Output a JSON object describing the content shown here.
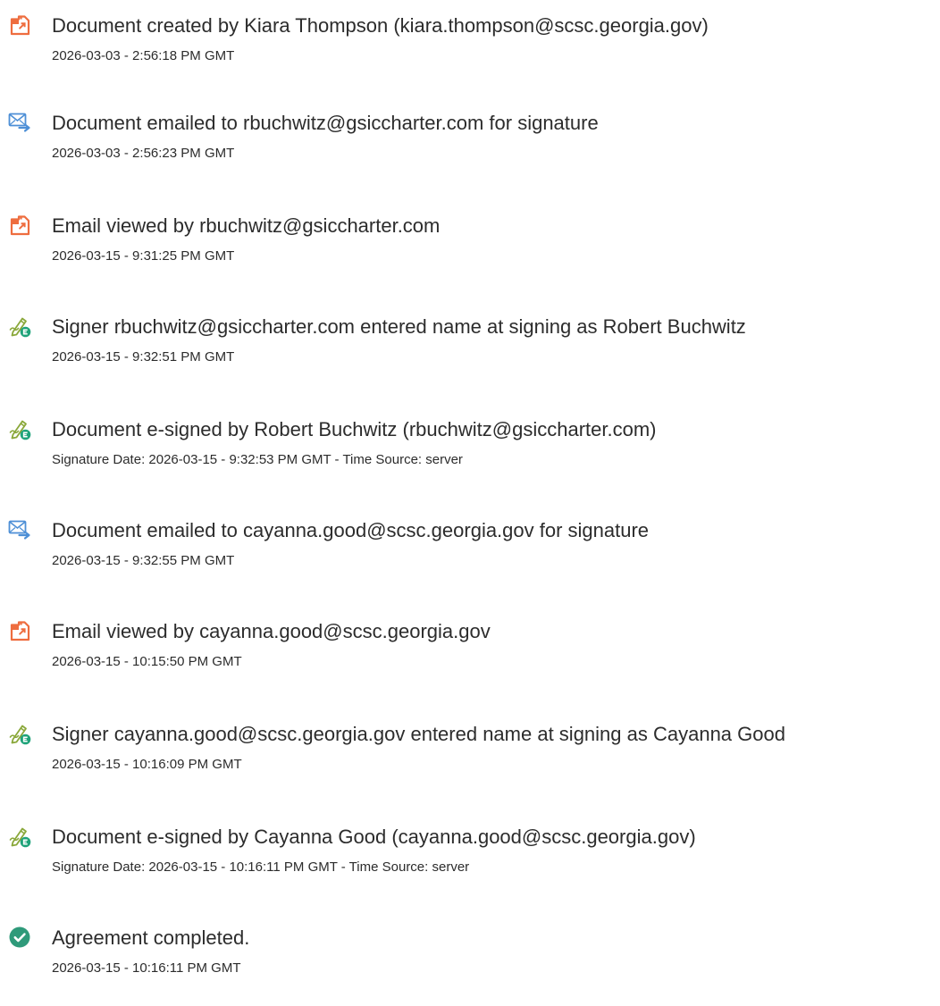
{
  "colors": {
    "document_icon": "#ee6d3f",
    "email_icon": "#4d8fd6",
    "signature_icon": "#8aa83a",
    "signature_badge": "#1fa37a",
    "completed_icon": "#2f9a7a"
  },
  "events": [
    {
      "icon": "document-created-icon",
      "title": "Document created by Kiara Thompson (kiara.thompson@scsc.georgia.gov)",
      "timestamp": "2026-03-03 - 2:56:18 PM GMT"
    },
    {
      "icon": "email-sent-icon",
      "title": "Document emailed to rbuchwitz@gsiccharter.com for signature",
      "timestamp": "2026-03-03 - 2:56:23 PM GMT"
    },
    {
      "icon": "document-viewed-icon",
      "title": "Email viewed by rbuchwitz@gsiccharter.com",
      "timestamp": "2026-03-15 - 9:31:25 PM GMT"
    },
    {
      "icon": "signature-pen-icon",
      "title": "Signer rbuchwitz@gsiccharter.com entered name at signing as Robert Buchwitz",
      "timestamp": "2026-03-15 - 9:32:51 PM GMT"
    },
    {
      "icon": "signature-pen-icon",
      "title": "Document e-signed by Robert Buchwitz (rbuchwitz@gsiccharter.com)",
      "timestamp": "Signature Date: 2026-03-15 - 9:32:53 PM GMT - Time Source: server"
    },
    {
      "icon": "email-sent-icon",
      "title": "Document emailed to cayanna.good@scsc.georgia.gov for signature",
      "timestamp": "2026-03-15 - 9:32:55 PM GMT"
    },
    {
      "icon": "document-viewed-icon",
      "title": "Email viewed by cayanna.good@scsc.georgia.gov",
      "timestamp": "2026-03-15 - 10:15:50 PM GMT"
    },
    {
      "icon": "signature-pen-icon",
      "title": "Signer cayanna.good@scsc.georgia.gov entered name at signing as Cayanna Good",
      "timestamp": "2026-03-15 - 10:16:09 PM GMT"
    },
    {
      "icon": "signature-pen-icon",
      "title": "Document e-signed by Cayanna Good (cayanna.good@scsc.georgia.gov)",
      "timestamp": "Signature Date: 2026-03-15 - 10:16:11 PM GMT - Time Source: server"
    },
    {
      "icon": "check-circle-icon",
      "title": "Agreement completed.",
      "timestamp": "2026-03-15 - 10:16:11 PM GMT"
    }
  ]
}
